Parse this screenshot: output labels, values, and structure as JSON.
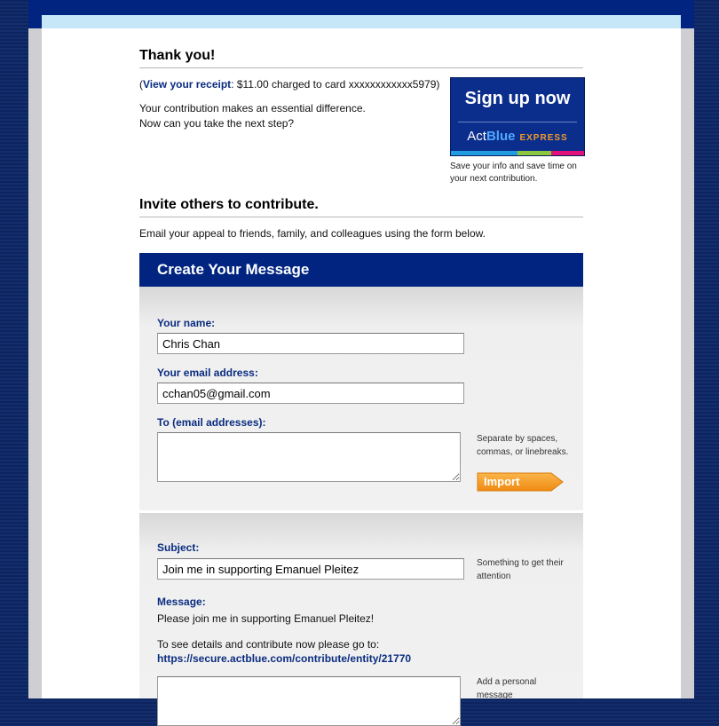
{
  "thanks": {
    "title": "Thank you!",
    "receipt_open": "(",
    "receipt_link": "View your receipt",
    "receipt_rest": ": $11.00 charged to card xxxxxxxxxxxx5979)",
    "line1": "Your contribution makes an essential difference.",
    "line2": "Now can you take the next step?"
  },
  "signup": {
    "headline": "Sign up now",
    "brand_act": "Act",
    "brand_blue": "Blue",
    "brand_express": "EXPRESS",
    "caption": "Save your info and save time on your next contribution.",
    "bar_colors": [
      "#1f9de0",
      "#1f9de0",
      "#8dc63f",
      "#e0127a"
    ]
  },
  "invite": {
    "title": "Invite others to contribute.",
    "text": "Email your appeal to friends, family, and colleagues using the form below."
  },
  "form": {
    "heading": "Create Your Message",
    "name_label": "Your name:",
    "name_value": "Chris Chan",
    "email_label": "Your email address:",
    "email_value": "cchan05@gmail.com",
    "to_label": "To (email addresses):",
    "to_hint": "Separate by spaces, commas, or linebreaks.",
    "import_label": "Import",
    "subject_label": "Subject:",
    "subject_value": "Join me in supporting Emanuel Pleitez",
    "subject_hint": "Something to get their attention",
    "message_label": "Message:",
    "message_line1": "Please join me in supporting Emanuel Pleitez!",
    "message_line2": "To see details and contribute now please go to:",
    "message_link": "https://secure.actblue.com/contribute/entity/21770",
    "personal_hint": "Add a personal message"
  },
  "colors": {
    "navy": "#002480",
    "label_blue": "#0a2c80",
    "import_orange": "#f39a1e"
  }
}
